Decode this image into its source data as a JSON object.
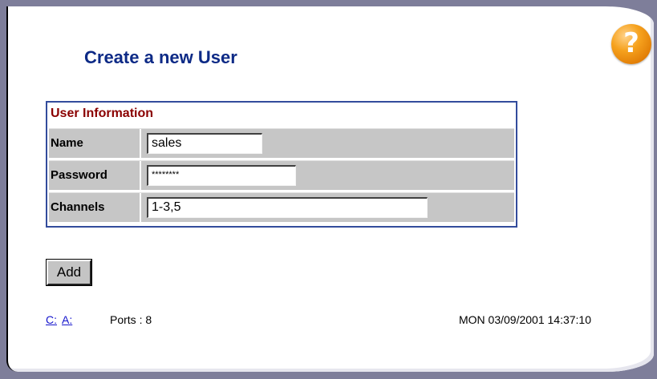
{
  "page": {
    "title": "Create a new User",
    "help_glyph": "?"
  },
  "form": {
    "section_title": "User Information",
    "rows": [
      {
        "label": "Name",
        "value": "sales"
      },
      {
        "label": "Password",
        "value": "********"
      },
      {
        "label": "Channels",
        "value": "1-3,5"
      }
    ]
  },
  "actions": {
    "add_label": "Add"
  },
  "footer": {
    "link_c": "C:",
    "link_a": "A:",
    "ports": "Ports : 8",
    "datetime": "MON 03/09/2001 14:37:10"
  },
  "icons": {
    "help": "help-question-icon"
  },
  "colors": {
    "title": "#0d2a86",
    "section_title": "#8a0000",
    "table_border": "#334c9c",
    "row_background": "#c6c6c6",
    "help_orange": "#f6a21e",
    "link": "#1414cc"
  }
}
